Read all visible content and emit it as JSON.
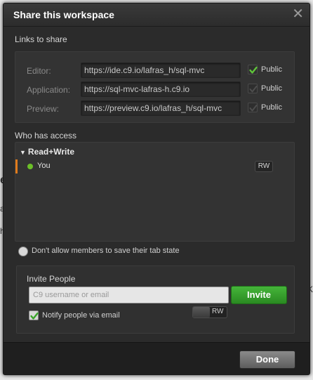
{
  "dialog": {
    "title": "Share this workspace"
  },
  "links": {
    "heading": "Links to share",
    "rows": [
      {
        "label": "Editor:",
        "url": "https://ide.c9.io/lafras_h/sql-mvc",
        "public_label": "Public",
        "public_checked": true
      },
      {
        "label": "Application:",
        "url": "https://sql-mvc-lafras-h.c9.io",
        "public_label": "Public",
        "public_checked": false
      },
      {
        "label": "Preview:",
        "url": "https://preview.c9.io/lafras_h/sql-mvc",
        "public_label": "Public",
        "public_checked": false
      }
    ]
  },
  "access": {
    "heading": "Who has access",
    "group_label": "Read+Write",
    "members": [
      {
        "name": "You",
        "permission": "RW",
        "online_color": "#6bbf28"
      }
    ]
  },
  "tab_state": {
    "label": "Don't allow members to save their tab state"
  },
  "invite": {
    "heading": "Invite People",
    "placeholder": "C9 username or email",
    "button_label": "Invite",
    "notify_label": "Notify people via email",
    "notify_checked": true,
    "permission_toggle_label": "RW"
  },
  "footer": {
    "done_label": "Done"
  },
  "colors": {
    "accent_green": "#2a8a22",
    "member_accent": "#e07b1c"
  }
}
